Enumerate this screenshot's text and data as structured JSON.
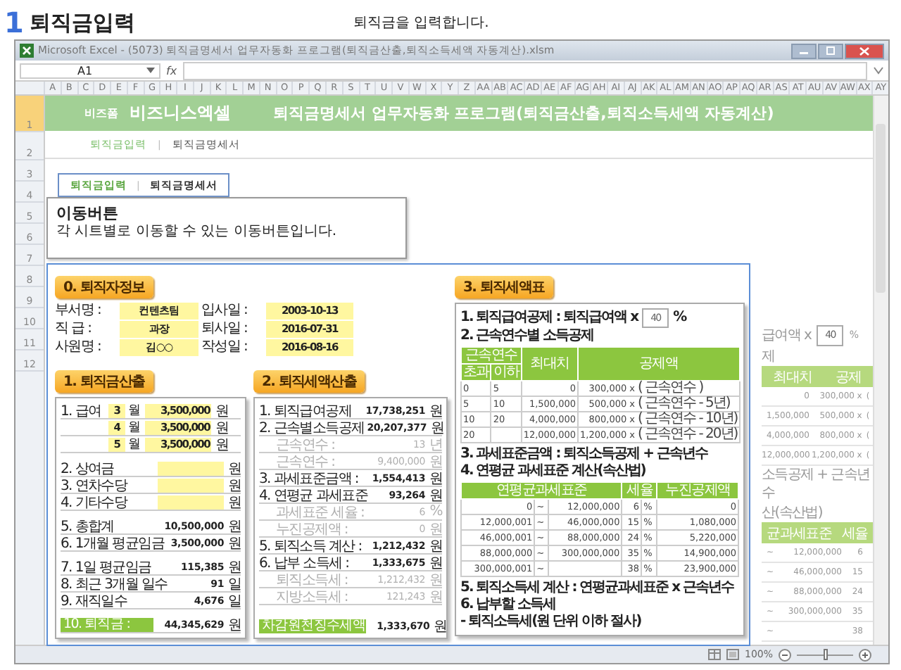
{
  "heading": {
    "number": "1",
    "title": "퇴직금입력",
    "subtitle": "퇴직금을 입력합니다."
  },
  "window": {
    "title": "Microsoft Excel - (5073) 퇴직금명세서 업무자동화 프로그램(퇴직금산출,퇴직소득세액 자동계산).xlsm"
  },
  "formula_bar": {
    "name_box": "A1",
    "fx": "fx"
  },
  "columns": [
    "A",
    "B",
    "C",
    "D",
    "E",
    "F",
    "G",
    "H",
    "I",
    "J",
    "K",
    "L",
    "M",
    "N",
    "O",
    "P",
    "Q",
    "R",
    "S",
    "T",
    "U",
    "V",
    "W",
    "X",
    "Y",
    "Z",
    "AA",
    "AB",
    "AC",
    "AD",
    "AE",
    "AF",
    "AG",
    "AH",
    "AI",
    "AJ",
    "AK",
    "AL",
    "AM",
    "AN",
    "AO",
    "AP",
    "AQ",
    "AR",
    "AS",
    "AT",
    "AU",
    "AV",
    "AW",
    "AX",
    "AY"
  ],
  "rows": [
    "1",
    "2",
    "3",
    "4",
    "5",
    "6",
    "7",
    "8",
    "9",
    "10",
    "11",
    "12"
  ],
  "banner": {
    "brand_small": "비즈폼",
    "brand": "비즈니스엑셀",
    "title": "퇴직금명세서 업무자동화 프로그램(퇴직금산출,퇴직소득세액 자동계산)"
  },
  "nav": {
    "separator": "|",
    "tabs": [
      {
        "label": "퇴직금입력",
        "selected": true
      },
      {
        "label": "퇴직금명세서",
        "selected": false
      }
    ]
  },
  "callout": {
    "nav": {
      "separator": "|",
      "tabs": [
        {
          "label": "퇴직금입력",
          "selected": true
        },
        {
          "label": "퇴직금명세서",
          "selected": false
        }
      ]
    },
    "title": "이동버튼",
    "text": "각 시트별로 이동할 수 있는 이동버튼입니다."
  },
  "panel": {
    "employee": {
      "title": "0. 퇴직자정보",
      "fields": [
        {
          "label": "부서명 :",
          "value": "컨텐츠팀"
        },
        {
          "label": "입사일 :",
          "value": "2003-10-13"
        },
        {
          "label": "직 급 :",
          "value": "과장"
        },
        {
          "label": "퇴사일 :",
          "value": "2016-07-31"
        },
        {
          "label": "사원명 :",
          "value": "김○○"
        },
        {
          "label": "작성일 :",
          "value": "2016-08-16"
        }
      ]
    },
    "severance": {
      "title": "1. 퇴직금산출",
      "groups": [
        [
          {
            "kind": "salary",
            "label": "1. 급여",
            "month": "3",
            "month_unit": "월",
            "value": "3,500,000",
            "unit": "원"
          },
          {
            "kind": "salary",
            "month": "4",
            "month_unit": "월",
            "value": "3,500,000",
            "unit": "원"
          },
          {
            "kind": "salary",
            "month": "5",
            "month_unit": "월",
            "value": "3,500,000",
            "unit": "원"
          }
        ],
        [
          {
            "kind": "input",
            "label": "2. 상여금",
            "unit": "원"
          },
          {
            "kind": "input",
            "label": "3. 연차수당",
            "unit": "원"
          },
          {
            "kind": "input",
            "label": "4. 기타수당",
            "unit": "원"
          }
        ],
        [
          {
            "kind": "amount",
            "label": "5. 총합계",
            "value": "10,500,000",
            "unit": "원"
          },
          {
            "kind": "amount",
            "label": "6. 1개월 평균임금",
            "value": "3,500,000",
            "unit": "원"
          }
        ],
        [
          {
            "kind": "amount",
            "label": "7. 1일 평균임금",
            "value": "115,385",
            "unit": "원"
          },
          {
            "kind": "amount",
            "label": "8. 최근 3개월 일수",
            "value": "91",
            "unit": "일"
          },
          {
            "kind": "amount",
            "label": "9. 재직일수",
            "value": "4,676",
            "unit": "일"
          }
        ],
        [
          {
            "kind": "total",
            "label": "10. 퇴직금 :",
            "value": "44,345,629",
            "unit": "원"
          }
        ]
      ]
    },
    "tax": {
      "title": "2. 퇴직세액산출",
      "rows": [
        {
          "kind": "main",
          "label": "1. 퇴직급여공제",
          "value": "17,738,251",
          "unit": "원"
        },
        {
          "kind": "main",
          "label": "2. 근속별소득공제",
          "value": "20,207,377",
          "unit": "원"
        },
        {
          "kind": "sub",
          "label": "근속연수 :",
          "value": "13",
          "unit": "년"
        },
        {
          "kind": "sub",
          "label": "근속연수 :",
          "value": "9,400,000",
          "unit": "원"
        },
        {
          "kind": "main",
          "label": "3. 과세표준금액 :",
          "value": "1,554,413",
          "unit": "원"
        },
        {
          "kind": "main",
          "label": "4. 연평균 과세표준",
          "value": "93,264",
          "unit": "원"
        },
        {
          "kind": "sub",
          "label": "과세표준 세율 :",
          "value": "6",
          "unit": "%"
        },
        {
          "kind": "sub",
          "label": "누진공제액 :",
          "value": "0",
          "unit": "원"
        },
        {
          "kind": "main",
          "label": "5. 퇴직소득 계산 :",
          "value": "1,212,432",
          "unit": "원"
        },
        {
          "kind": "main",
          "label": "6. 납부 소득세 :",
          "value": "1,333,675",
          "unit": "원"
        },
        {
          "kind": "sub",
          "label": "퇴직소득세 :",
          "value": "1,212,432",
          "unit": "원"
        },
        {
          "kind": "sub",
          "label": "지방소득세 :",
          "value": "121,243",
          "unit": "원"
        },
        {
          "kind": "total",
          "label": "차감원천징수세액",
          "value": "1,333,670",
          "unit": "원"
        }
      ]
    },
    "table": {
      "title": "3. 퇴직세액표",
      "deduction": {
        "text": "1. 퇴직급여공제 : 퇴직급여액 x",
        "rate": "40",
        "unit": "%"
      },
      "service_title": "2. 근속연수별 소득공제",
      "service_table": {
        "group_header": "근속연수",
        "sub_headers": [
          "초과",
          "이하"
        ],
        "headers": [
          "최대치",
          "공제액"
        ],
        "rows": [
          {
            "over": "0",
            "upto": "5",
            "max": "0",
            "base": "300,000",
            "times": "x",
            "formula": "( 근속연수 )"
          },
          {
            "over": "5",
            "upto": "10",
            "max": "1,500,000",
            "base": "500,000",
            "times": "x",
            "formula": "( 근속연수 - 5년)"
          },
          {
            "over": "10",
            "upto": "20",
            "max": "4,000,000",
            "base": "800,000",
            "times": "x",
            "formula": "( 근속연수 - 10년)"
          },
          {
            "over": "20",
            "max": "12,000,000",
            "base": "1,200,000",
            "times": "x",
            "formula": "( 근속연수 - 20년)"
          }
        ]
      },
      "middle_lines": [
        "3. 과세표준금액 : 퇴직소득공제 + 근속년수",
        "4. 연평균 과세표준 계산(속산법)"
      ],
      "rate_table": {
        "headers": [
          "연평균과세표준",
          "세율",
          "누진공제액"
        ],
        "rows": [
          {
            "from": "0",
            "tilde": "~",
            "to": "12,000,000",
            "rate": "6",
            "pct": "%",
            "deduction": "0"
          },
          {
            "from": "12,000,001",
            "tilde": "~",
            "to": "46,000,000",
            "rate": "15",
            "pct": "%",
            "deduction": "1,080,000"
          },
          {
            "from": "46,000,001",
            "tilde": "~",
            "to": "88,000,000",
            "rate": "24",
            "pct": "%",
            "deduction": "5,220,000"
          },
          {
            "from": "88,000,000",
            "tilde": "~",
            "to": "300,000,000",
            "rate": "35",
            "pct": "%",
            "deduction": "14,900,000"
          },
          {
            "from": "300,000,001",
            "tilde": "~",
            "rate": "38",
            "pct": "%",
            "deduction": "23,900,000"
          }
        ]
      },
      "end_lines": [
        "5. 퇴직소득세 계산 : 연평균과세표준 x 근속년수",
        "6. 납부할 소득세",
        "- 퇴직소득세(원 단위 이하 절사)"
      ]
    }
  },
  "background": {
    "deduction": {
      "text": "급여액 x",
      "rate": "40",
      "unit": "%"
    },
    "line": "제",
    "table_headers": [
      "최대치",
      "공제"
    ],
    "rows": [
      {
        "max": "0",
        "base": "300,000",
        "times": "x",
        "paren": "("
      },
      {
        "max": "1,500,000",
        "base": "500,000",
        "times": "x",
        "paren": "("
      },
      {
        "max": "4,000,000",
        "base": "800,000",
        "times": "x",
        "paren": "("
      },
      {
        "max": "12,000,000",
        "base": "1,200,000",
        "times": "x",
        "paren": "("
      }
    ],
    "lines": [
      "소득공제 + 근속년수",
      "산(속산법)"
    ],
    "rate_headers": [
      "균과세표준",
      "세율"
    ],
    "rate_rows": [
      {
        "tilde": "~",
        "to": "12,000,000",
        "rate": "6"
      },
      {
        "tilde": "~",
        "to": "46,000,000",
        "rate": "15"
      },
      {
        "tilde": "~",
        "to": "88,000,000",
        "rate": "24"
      },
      {
        "tilde": "~",
        "to": "300,000,000",
        "rate": "35"
      },
      {
        "tilde": "~",
        "rate": "38"
      }
    ]
  },
  "status_bar": {
    "zoom": "100%",
    "level": 0.5
  }
}
